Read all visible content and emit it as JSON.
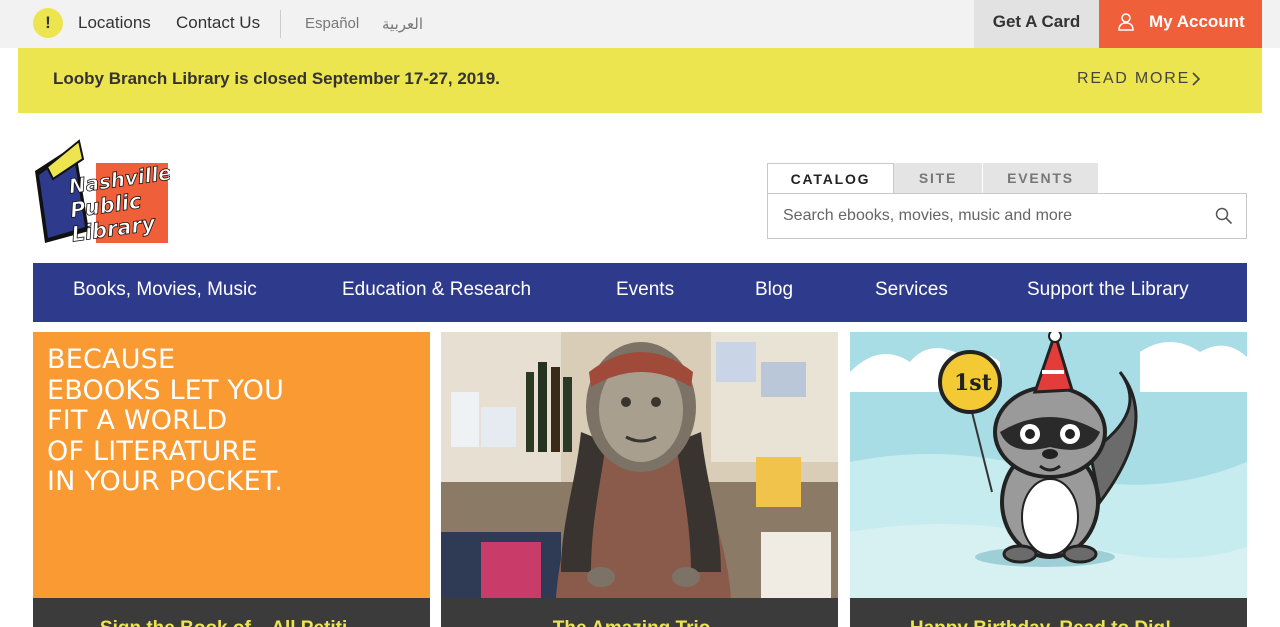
{
  "utility": {
    "alert_glyph": "!",
    "links": [
      "Locations",
      "Contact Us"
    ],
    "languages": [
      "Español",
      "العربية"
    ],
    "get_card_label": "Get A Card",
    "account_label": "My Account"
  },
  "alert": {
    "message": "Looby Branch Library is closed September 17-27, 2019.",
    "read_more": "READ MORE"
  },
  "logo": {
    "lines": [
      "Nashville",
      "Public",
      "Library"
    ]
  },
  "search": {
    "tabs": [
      "CATALOG",
      "SITE",
      "EVENTS"
    ],
    "active_tab": "CATALOG",
    "placeholder": "Search ebooks, movies, music and more",
    "value": ""
  },
  "nav": {
    "items": [
      "Books, Movies, Music",
      "Education & Research",
      "Events",
      "Blog",
      "Services",
      "Support the Library"
    ]
  },
  "cards": [
    {
      "image": "ebooks-promo",
      "promo_lines": [
        "BECAUSE",
        "EBOOKS LET YOU",
        "FIT A WORLD",
        "OF LITERATURE",
        "IN YOUR POCKET."
      ],
      "title": "Sign the Book of... All Petiti..."
    },
    {
      "image": "puppet-photo",
      "title": "The Amazing Trio..."
    },
    {
      "image": "raccoon-birthday-illustration",
      "balloon_text": "1st",
      "title": "Happy Birthday, Read to Dig!..."
    }
  ],
  "colors": {
    "utility_bg": "#f2f2f2",
    "alert_yellow": "#ede54f",
    "account_orange": "#ef5f3a",
    "nav_blue": "#2e3a8c",
    "promo_orange": "#f99a32",
    "caption_dark": "#3b3b3b",
    "sky_blue": "#a9dde6"
  }
}
